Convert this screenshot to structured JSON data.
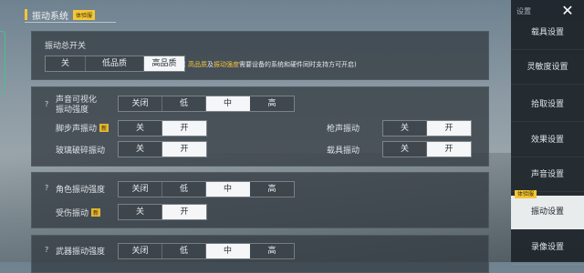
{
  "header": {
    "title": "振动系统",
    "badge": "体验服"
  },
  "master": {
    "label": "振动总开关",
    "options": [
      "关",
      "低品质",
      "高品质"
    ],
    "selected": "高品质",
    "note_part1": "高品质",
    "note_part2": "及",
    "note_part3": "振动强度",
    "note_part4": "需要设备的系统和硬件同时支持方可开启"
  },
  "sound": {
    "help": "?",
    "label_line1": "声音可视化",
    "label_line2": "振动强度",
    "options": [
      "关闭",
      "低",
      "中",
      "高"
    ],
    "selected": "中",
    "footstep": {
      "label": "脚步声振动",
      "badge": "新",
      "options": [
        "关",
        "开"
      ],
      "selected": "开"
    },
    "glass": {
      "label": "玻璃破碎振动",
      "options": [
        "关",
        "开"
      ],
      "selected": "开"
    },
    "gunshot": {
      "label": "枪声振动",
      "options": [
        "关",
        "开"
      ],
      "selected": "开"
    },
    "vehicle": {
      "label": "载具振动",
      "options": [
        "关",
        "开"
      ],
      "selected": "开"
    }
  },
  "character": {
    "help": "?",
    "label": "角色振动强度",
    "options": [
      "关闭",
      "低",
      "中",
      "高"
    ],
    "selected": "中",
    "hurt": {
      "label": "受伤振动",
      "badge": "新",
      "options": [
        "关",
        "开"
      ],
      "selected": "开"
    }
  },
  "weapon": {
    "help": "?",
    "label": "武器振动强度",
    "options": [
      "关闭",
      "低",
      "中",
      "高"
    ],
    "selected": "中"
  },
  "sidebar": {
    "header": "设置",
    "items": [
      "载具设置",
      "灵敏度设置",
      "拾取设置",
      "效果设置",
      "声音设置",
      "振动设置",
      "录像设置"
    ],
    "active": "振动设置",
    "active_badge": "体验服"
  },
  "colors": {
    "accent": "#f3c43b",
    "selected_bg": "#f4f6f8",
    "panel_bg": "#343c42"
  }
}
